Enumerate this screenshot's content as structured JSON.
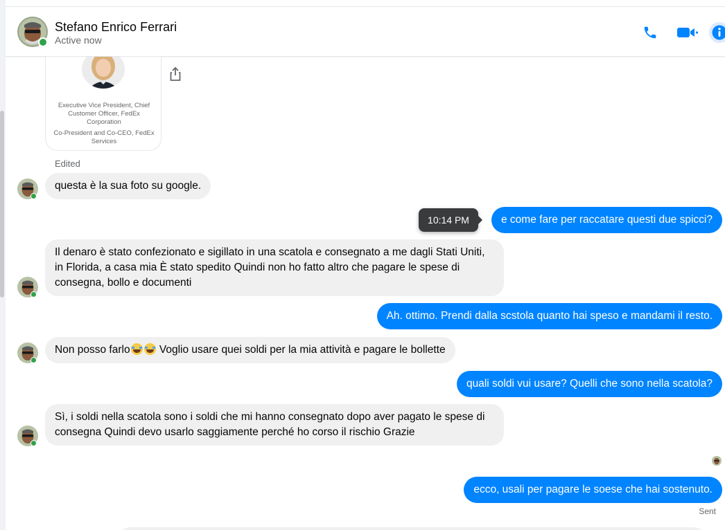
{
  "header": {
    "name": "Stefano Enrico Ferrari",
    "status": "Active now",
    "icons": [
      "phone-icon",
      "video-icon",
      "info-icon"
    ],
    "accent_color": "#0084ff",
    "online_color": "#31a24c"
  },
  "card": {
    "line1": "Executive Vice President, Chief Customer Officer, FedEx Corporation",
    "line2": "Co-President and Co-CEO, FedEx Services",
    "share_icon": "share-icon"
  },
  "edited_label": "Edited",
  "tooltip_time": "10:14 PM",
  "messages": [
    {
      "from": "them",
      "text": "questa è la sua foto su google."
    },
    {
      "from": "me",
      "text": "e come fare per raccatare questi due spicci?"
    },
    {
      "from": "them",
      "text": "Il denaro è stato confezionato e sigillato in una scatola e consegnato a me dagli Stati Uniti, in Florida, a casa mia È stato spedito Quindi non ho fatto altro che pagare le spese di consegna, bollo e documenti"
    },
    {
      "from": "me",
      "text": "Ah. ottimo. Prendi dalla scstola quanto hai speso e mandami il resto."
    },
    {
      "from": "them",
      "text_before": "Non posso farlo",
      "emojis": [
        "tears-of-joy-emoji",
        "tears-of-joy-emoji"
      ],
      "text_after": " Voglio usare quei soldi per la mia attività e pagare le bollette"
    },
    {
      "from": "me",
      "text": "quali soldi vui usare? Quelli che sono nella scatola?"
    },
    {
      "from": "them",
      "text": "Sì, i soldi nella scatola sono i soldi che mi hanno consegnato dopo aver pagato le spese di consegna Quindi devo usarlo saggiamente perché ho corso il rischio Grazie"
    },
    {
      "from": "me",
      "text": "ecco, usali per pagare le soese che hai sostenuto."
    }
  ],
  "sent_label": "Sent"
}
